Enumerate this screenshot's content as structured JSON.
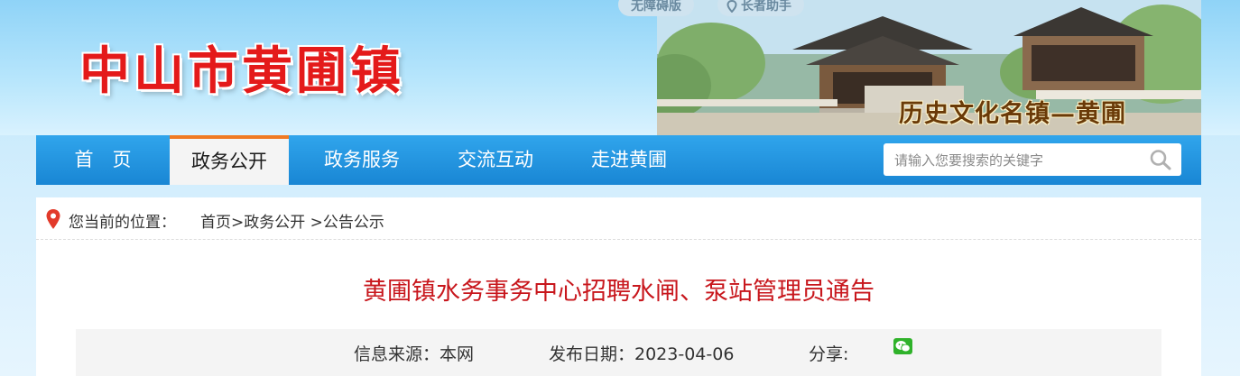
{
  "header": {
    "site_title": "中山市黄圃镇",
    "accessibility_label": "无障碍版",
    "elder_label": "长者助手",
    "banner_slogan": "历史文化名镇—黄圃"
  },
  "nav": {
    "items": [
      {
        "label": "首　页"
      },
      {
        "label": "政务公开",
        "active": true
      },
      {
        "label": "政务服务"
      },
      {
        "label": "交流互动"
      },
      {
        "label": "走进黄圃"
      }
    ],
    "search_placeholder": "请输入您要搜索的关键字",
    "search_icon": "search-icon"
  },
  "breadcrumb": {
    "prefix": "您当前的位置：",
    "path": "首页>政务公开 >公告公示",
    "icon": "location-pin-icon"
  },
  "article": {
    "title": "黄圃镇水务事务中心招聘水闸、泵站管理员通告",
    "source_label": "信息来源：本网",
    "date_label": "发布日期：2023-04-06",
    "share_label": "分享:",
    "share_icon": "wechat-icon"
  },
  "colors": {
    "nav_blue": "#1f8fdc",
    "active_accent": "#f07a22",
    "title_red": "#c8171d",
    "site_title_red": "#e41a1a"
  }
}
